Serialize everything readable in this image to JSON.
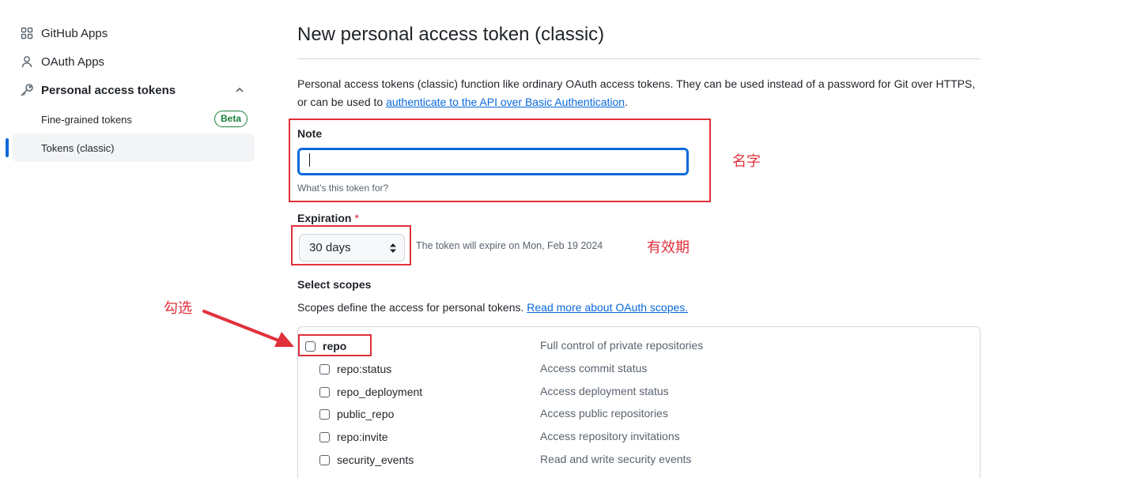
{
  "sidebar": {
    "items": [
      {
        "label": "GitHub Apps",
        "icon": "apps-icon"
      },
      {
        "label": "OAuth Apps",
        "icon": "person-icon"
      },
      {
        "label": "Personal access tokens",
        "icon": "key-icon"
      }
    ],
    "sub_items": [
      {
        "label": "Fine-grained tokens",
        "badge": "Beta"
      },
      {
        "label": "Tokens (classic)",
        "active": true
      }
    ]
  },
  "main": {
    "title": "New personal access token (classic)",
    "intro_text": "Personal access tokens (classic) function like ordinary OAuth access tokens. They can be used instead of a password for Git over HTTPS, or can be used to ",
    "intro_link": "authenticate to the API over Basic Authentication",
    "intro_end": ".",
    "note": {
      "label": "Note",
      "value": "",
      "hint": "What’s this token for?"
    },
    "expiration": {
      "label": "Expiration",
      "required_mark": "*",
      "selected": "30 days",
      "expire_text": "The token will expire on Mon, Feb 19 2024"
    },
    "scopes": {
      "label": "Select scopes",
      "desc": "Scopes define the access for personal tokens. ",
      "desc_link": "Read more about OAuth scopes.",
      "items": [
        {
          "name": "repo",
          "desc": "Full control of private repositories",
          "parent": true
        },
        {
          "name": "repo:status",
          "desc": "Access commit status"
        },
        {
          "name": "repo_deployment",
          "desc": "Access deployment status"
        },
        {
          "name": "public_repo",
          "desc": "Access public repositories"
        },
        {
          "name": "repo:invite",
          "desc": "Access repository invitations"
        },
        {
          "name": "security_events",
          "desc": "Read and write security events"
        }
      ]
    }
  },
  "annotations": {
    "name": "名字",
    "validity": "有效期",
    "check": "勾选",
    "color": "#e0303a"
  },
  "colors": {
    "accent": "#0969da",
    "beta_green": "#1a7f37",
    "required_red": "#d1242f"
  }
}
